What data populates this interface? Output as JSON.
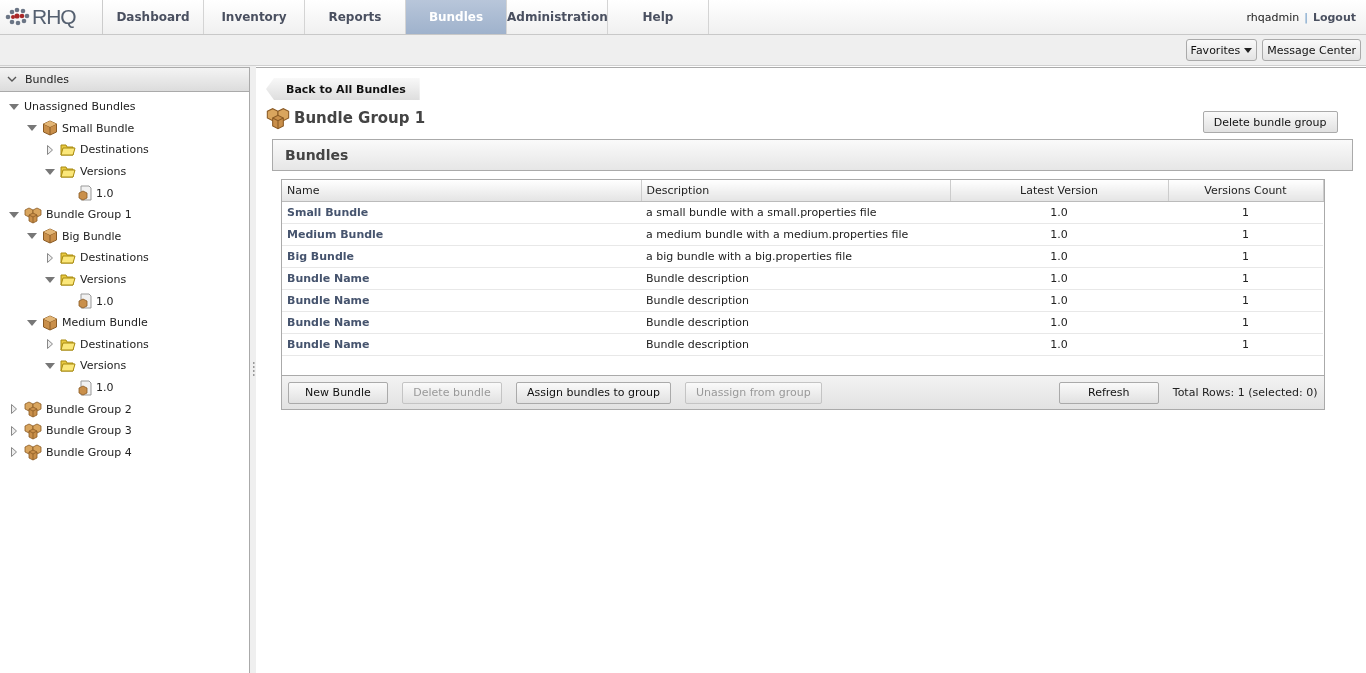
{
  "header": {
    "logo": "RHQ",
    "tabs": [
      {
        "label": "Dashboard",
        "selected": false
      },
      {
        "label": "Inventory",
        "selected": false
      },
      {
        "label": "Reports",
        "selected": false
      },
      {
        "label": "Bundles",
        "selected": true
      },
      {
        "label": "Administration",
        "selected": false
      },
      {
        "label": "Help",
        "selected": false
      }
    ],
    "user": "rhqadmin",
    "separator": "|",
    "logout": "Logout"
  },
  "toolbar": {
    "favorites": "Favorites",
    "message_center": "Message Center"
  },
  "sidebar": {
    "title": "Bundles",
    "tree": [
      {
        "label": "Unassigned Bundles",
        "kind": "root",
        "expanded": true,
        "children": [
          {
            "label": "Small Bundle",
            "kind": "bundle",
            "expanded": true,
            "children": [
              {
                "label": "Destinations",
                "kind": "folder",
                "expanded": false
              },
              {
                "label": "Versions",
                "kind": "folder",
                "expanded": true,
                "children": [
                  {
                    "label": "1.0",
                    "kind": "version"
                  }
                ]
              }
            ]
          }
        ]
      },
      {
        "label": "Bundle Group 1",
        "kind": "group",
        "expanded": true,
        "children": [
          {
            "label": "Big Bundle",
            "kind": "bundle",
            "expanded": true,
            "children": [
              {
                "label": "Destinations",
                "kind": "folder",
                "expanded": false
              },
              {
                "label": "Versions",
                "kind": "folder",
                "expanded": true,
                "children": [
                  {
                    "label": "1.0",
                    "kind": "version"
                  }
                ]
              }
            ]
          },
          {
            "label": "Medium Bundle",
            "kind": "bundle",
            "expanded": true,
            "children": [
              {
                "label": "Destinations",
                "kind": "folder",
                "expanded": false
              },
              {
                "label": "Versions",
                "kind": "folder",
                "expanded": true,
                "children": [
                  {
                    "label": "1.0",
                    "kind": "version"
                  }
                ]
              }
            ]
          }
        ]
      },
      {
        "label": "Bundle Group 2",
        "kind": "group",
        "expanded": false
      },
      {
        "label": "Bundle Group 3",
        "kind": "group",
        "expanded": false
      },
      {
        "label": "Bundle Group 4",
        "kind": "group",
        "expanded": false
      }
    ]
  },
  "main": {
    "back_button": "Back to All Bundles",
    "title": "Bundle Group 1",
    "delete_group_button": "Delete bundle group",
    "section_title": "Bundles",
    "table": {
      "columns": [
        "Name",
        "Description",
        "Latest Version",
        "Versions Count"
      ],
      "rows": [
        [
          "Small Bundle",
          "a small bundle with a small.properties file",
          "1.0",
          "1"
        ],
        [
          "Medium Bundle",
          "a medium bundle with a medium.properties file",
          "1.0",
          "1"
        ],
        [
          "Big Bundle",
          "a big bundle with a big.properties file",
          "1.0",
          "1"
        ],
        [
          "Bundle Name",
          "Bundle description",
          "1.0",
          "1"
        ],
        [
          "Bundle Name",
          "Bundle description",
          "1.0",
          "1"
        ],
        [
          "Bundle Name",
          "Bundle description",
          "1.0",
          "1"
        ],
        [
          "Bundle Name",
          "Bundle description",
          "1.0",
          "1"
        ]
      ],
      "buttons": [
        {
          "label": "New Bundle",
          "disabled": false
        },
        {
          "label": "Delete bundle",
          "disabled": true
        },
        {
          "label": "Assign bundles to group",
          "disabled": false
        },
        {
          "label": "Unassign from group",
          "disabled": true
        },
        {
          "label": "Refresh",
          "disabled": false
        }
      ],
      "status": "Total Rows: 1 (selected: 0)"
    }
  }
}
